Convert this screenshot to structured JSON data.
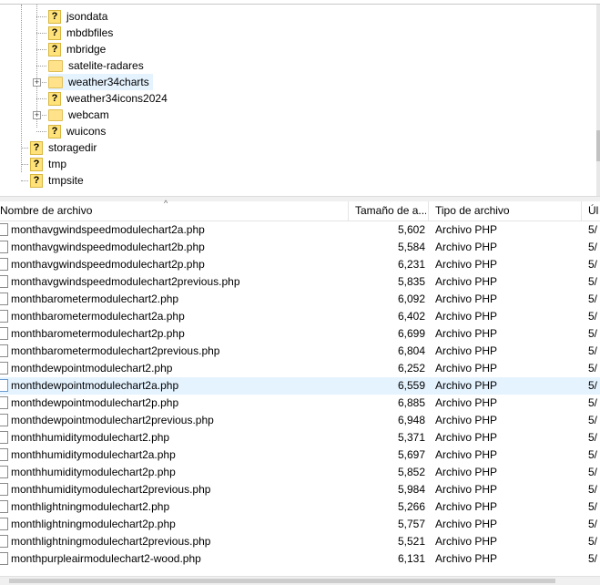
{
  "tree": {
    "items": [
      {
        "label": "jsondata",
        "icon": "question-folder-icon",
        "indent": 2,
        "expandable": false
      },
      {
        "label": "mbdbfiles",
        "icon": "question-folder-icon",
        "indent": 2,
        "expandable": false
      },
      {
        "label": "mbridge",
        "icon": "question-folder-icon",
        "indent": 2,
        "expandable": false
      },
      {
        "label": "satelite-radares",
        "icon": "folder-icon",
        "indent": 2,
        "expandable": false
      },
      {
        "label": "weather34charts",
        "icon": "folder-icon",
        "indent": 2,
        "expandable": true,
        "highlighted": true
      },
      {
        "label": "weather34icons2024",
        "icon": "question-folder-icon",
        "indent": 2,
        "expandable": false
      },
      {
        "label": "webcam",
        "icon": "folder-icon",
        "indent": 2,
        "expandable": true
      },
      {
        "label": "wuicons",
        "icon": "question-folder-icon",
        "indent": 2,
        "expandable": false
      },
      {
        "label": "storagedir",
        "icon": "question-folder-icon",
        "indent": 1,
        "expandable": false
      },
      {
        "label": "tmp",
        "icon": "question-folder-icon",
        "indent": 1,
        "expandable": false
      },
      {
        "label": "tmpsite",
        "icon": "question-folder-icon",
        "indent": 1,
        "expandable": false
      }
    ],
    "question_glyph": "?",
    "expander_glyph": "+"
  },
  "list": {
    "columns": {
      "name": "Nombre de archivo",
      "size": "Tamaño de a...",
      "type": "Tipo de archivo",
      "last": "Úl"
    },
    "sort_glyph": "^",
    "rows": [
      {
        "name": "monthavgwindspeedmodulechart2a.php",
        "size": "5,602",
        "type": "Archivo PHP",
        "last": "5/"
      },
      {
        "name": "monthavgwindspeedmodulechart2b.php",
        "size": "5,584",
        "type": "Archivo PHP",
        "last": "5/"
      },
      {
        "name": "monthavgwindspeedmodulechart2p.php",
        "size": "6,231",
        "type": "Archivo PHP",
        "last": "5/"
      },
      {
        "name": "monthavgwindspeedmodulechart2previous.php",
        "size": "5,835",
        "type": "Archivo PHP",
        "last": "5/"
      },
      {
        "name": "monthbarometermodulechart2.php",
        "size": "6,092",
        "type": "Archivo PHP",
        "last": "5/"
      },
      {
        "name": "monthbarometermodulechart2a.php",
        "size": "6,402",
        "type": "Archivo PHP",
        "last": "5/"
      },
      {
        "name": "monthbarometermodulechart2p.php",
        "size": "6,699",
        "type": "Archivo PHP",
        "last": "5/"
      },
      {
        "name": "monthbarometermodulechart2previous.php",
        "size": "6,804",
        "type": "Archivo PHP",
        "last": "5/"
      },
      {
        "name": "monthdewpointmodulechart2.php",
        "size": "6,252",
        "type": "Archivo PHP",
        "last": "5/"
      },
      {
        "name": "monthdewpointmodulechart2a.php",
        "size": "6,559",
        "type": "Archivo PHP",
        "last": "5/",
        "selected": true
      },
      {
        "name": "monthdewpointmodulechart2p.php",
        "size": "6,885",
        "type": "Archivo PHP",
        "last": "5/"
      },
      {
        "name": "monthdewpointmodulechart2previous.php",
        "size": "6,948",
        "type": "Archivo PHP",
        "last": "5/"
      },
      {
        "name": "monthhumiditymodulechart2.php",
        "size": "5,371",
        "type": "Archivo PHP",
        "last": "5/"
      },
      {
        "name": "monthhumiditymodulechart2a.php",
        "size": "5,697",
        "type": "Archivo PHP",
        "last": "5/"
      },
      {
        "name": "monthhumiditymodulechart2p.php",
        "size": "5,852",
        "type": "Archivo PHP",
        "last": "5/"
      },
      {
        "name": "monthhumiditymodulechart2previous.php",
        "size": "5,984",
        "type": "Archivo PHP",
        "last": "5/"
      },
      {
        "name": "monthlightningmodulechart2.php",
        "size": "5,266",
        "type": "Archivo PHP",
        "last": "5/"
      },
      {
        "name": "monthlightningmodulechart2p.php",
        "size": "5,757",
        "type": "Archivo PHP",
        "last": "5/"
      },
      {
        "name": "monthlightningmodulechart2previous.php",
        "size": "5,521",
        "type": "Archivo PHP",
        "last": "5/"
      },
      {
        "name": "monthpurpleairmodulechart2-wood.php",
        "size": "6,131",
        "type": "Archivo PHP",
        "last": "5/"
      }
    ]
  },
  "colors": {
    "selection": "#e5f3ff",
    "folder": "#ffe289"
  }
}
